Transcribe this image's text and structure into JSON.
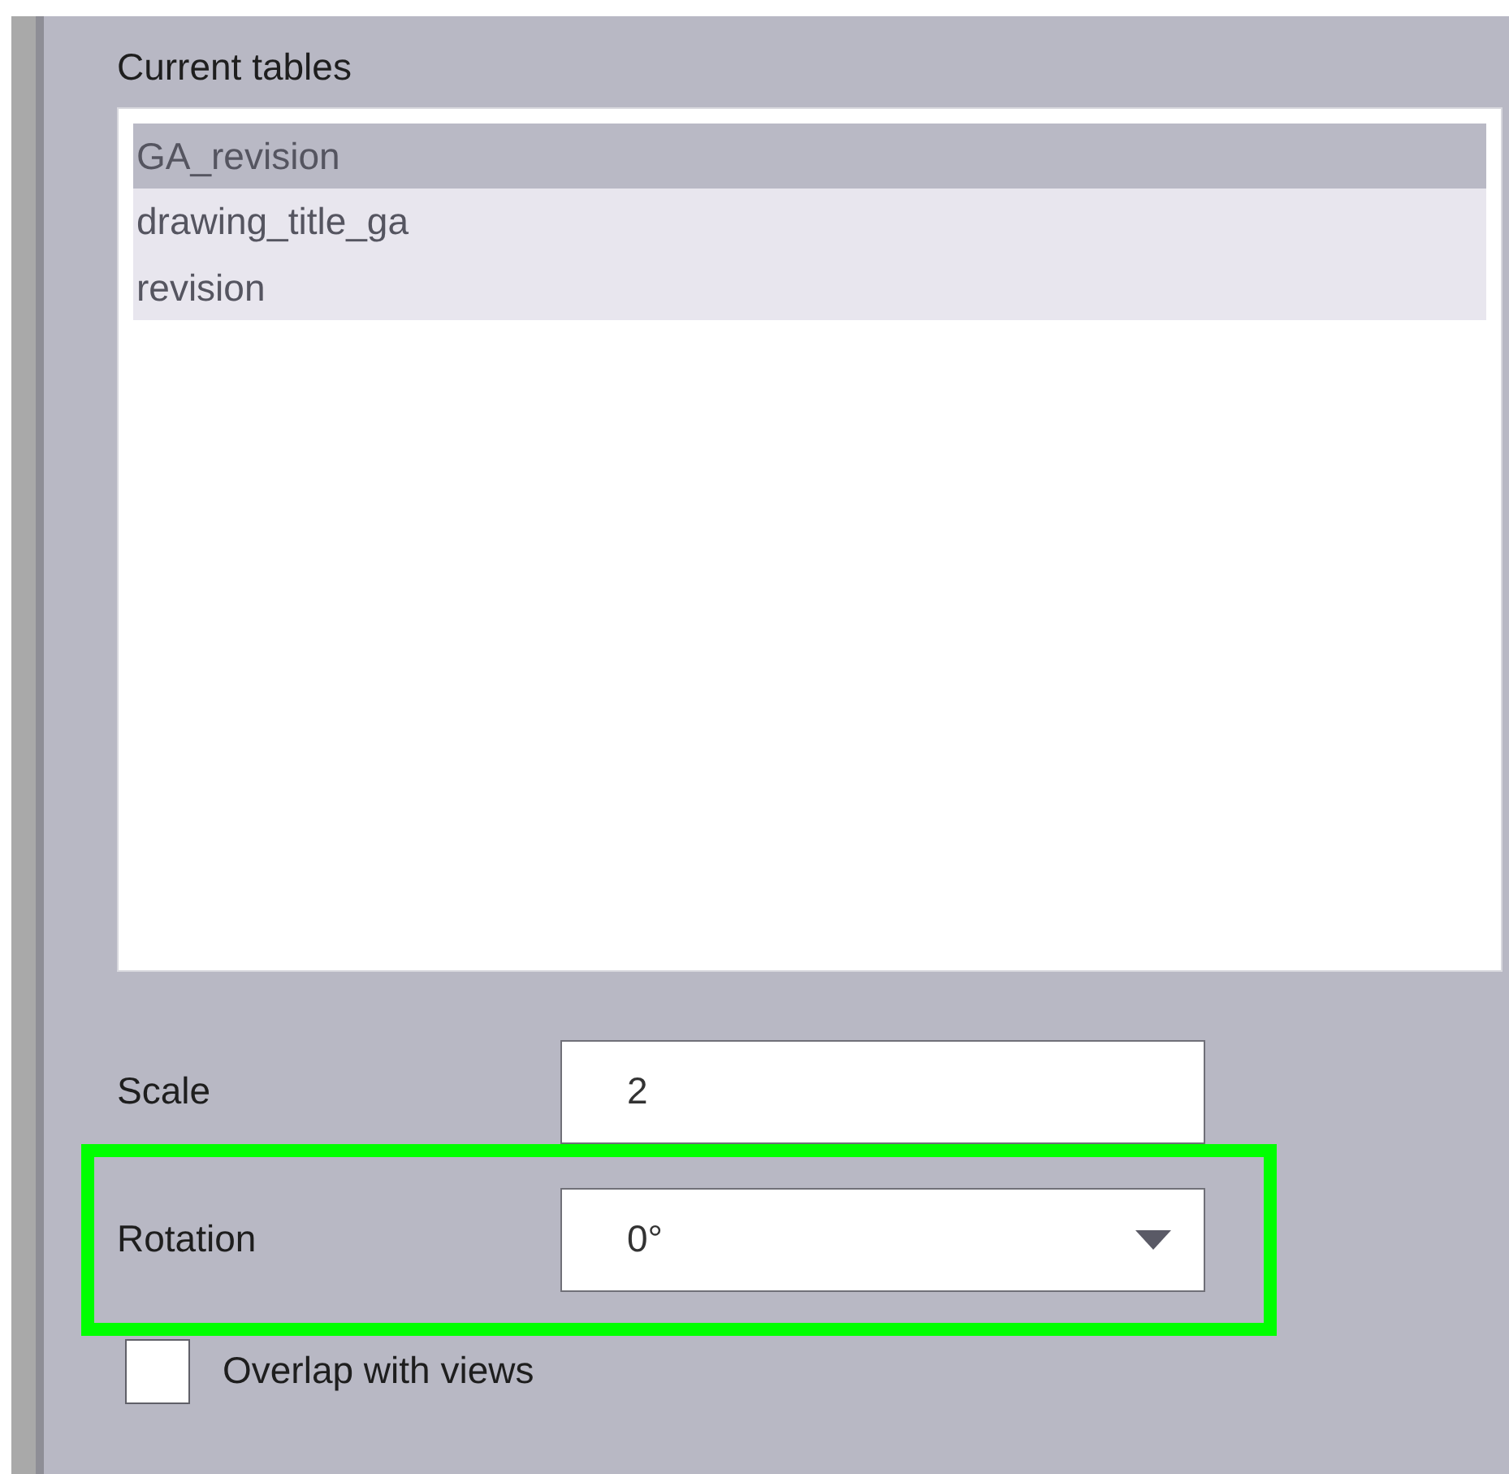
{
  "list": {
    "label": "Current tables",
    "items": [
      {
        "text": "GA_revision",
        "selected": true
      },
      {
        "text": "drawing_title_ga",
        "selected": false
      },
      {
        "text": "revision",
        "selected": false
      }
    ]
  },
  "fields": [
    {
      "kind": "text",
      "label": "Scale",
      "value": "2",
      "highlighted": false
    },
    {
      "kind": "dropdown",
      "label": "Rotation",
      "value": "0°",
      "highlighted": true
    }
  ],
  "checkbox": {
    "label": "Overlap with views",
    "checked": false
  }
}
